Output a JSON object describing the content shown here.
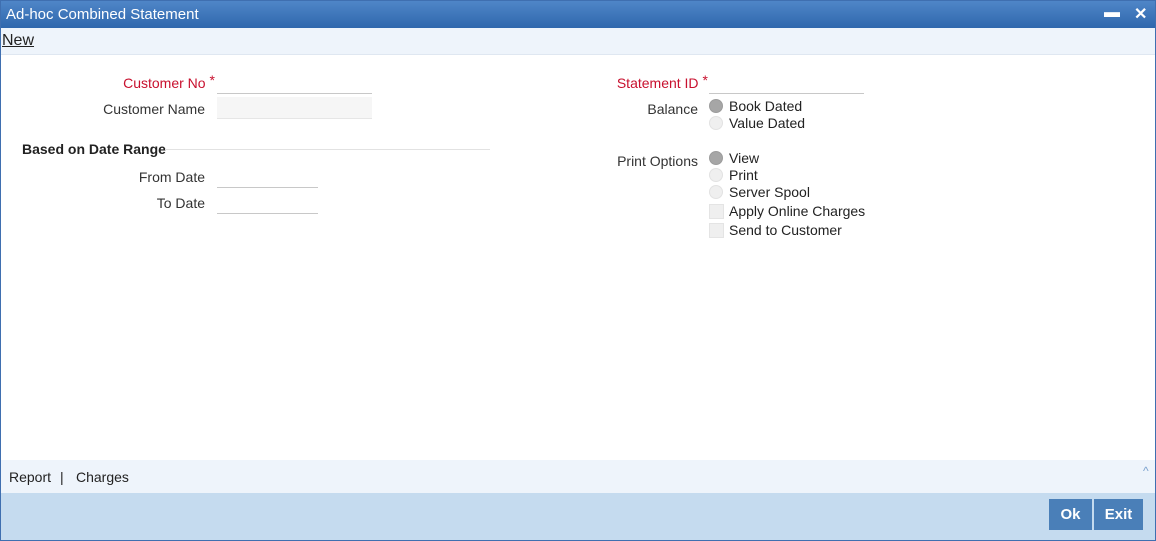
{
  "window": {
    "title": "Ad-hoc Combined Statement",
    "minimize_glyph": "▬",
    "close_glyph": "✕"
  },
  "menu": {
    "new_label": "New"
  },
  "form": {
    "customer_no": {
      "label": "Customer No",
      "required_mark": "*",
      "value": ""
    },
    "customer_name": {
      "label": "Customer Name",
      "value": ""
    },
    "date_range": {
      "title": "Based on Date Range",
      "from_date": {
        "label": "From Date",
        "value": ""
      },
      "to_date": {
        "label": "To Date",
        "value": ""
      }
    },
    "statement_id": {
      "label": "Statement ID",
      "required_mark": "*",
      "value": ""
    },
    "balance": {
      "label": "Balance",
      "options": [
        "Book Dated",
        "Value Dated"
      ],
      "selected": "Book Dated"
    },
    "print_options": {
      "label": "Print Options",
      "options": [
        "View",
        "Print",
        "Server Spool"
      ],
      "selected": "View"
    },
    "checkboxes": [
      {
        "label": "Apply Online Charges",
        "checked": false
      },
      {
        "label": "Send to Customer",
        "checked": false
      }
    ]
  },
  "footer": {
    "links": [
      "Report",
      "Charges"
    ],
    "separator": "|"
  },
  "buttons": {
    "ok": "Ok",
    "exit": "Exit"
  },
  "colors": {
    "titlebar": "#2f67ad",
    "required": "#c8102e",
    "button": "#4a7fb8",
    "footer_bg": "#c5dbef"
  }
}
